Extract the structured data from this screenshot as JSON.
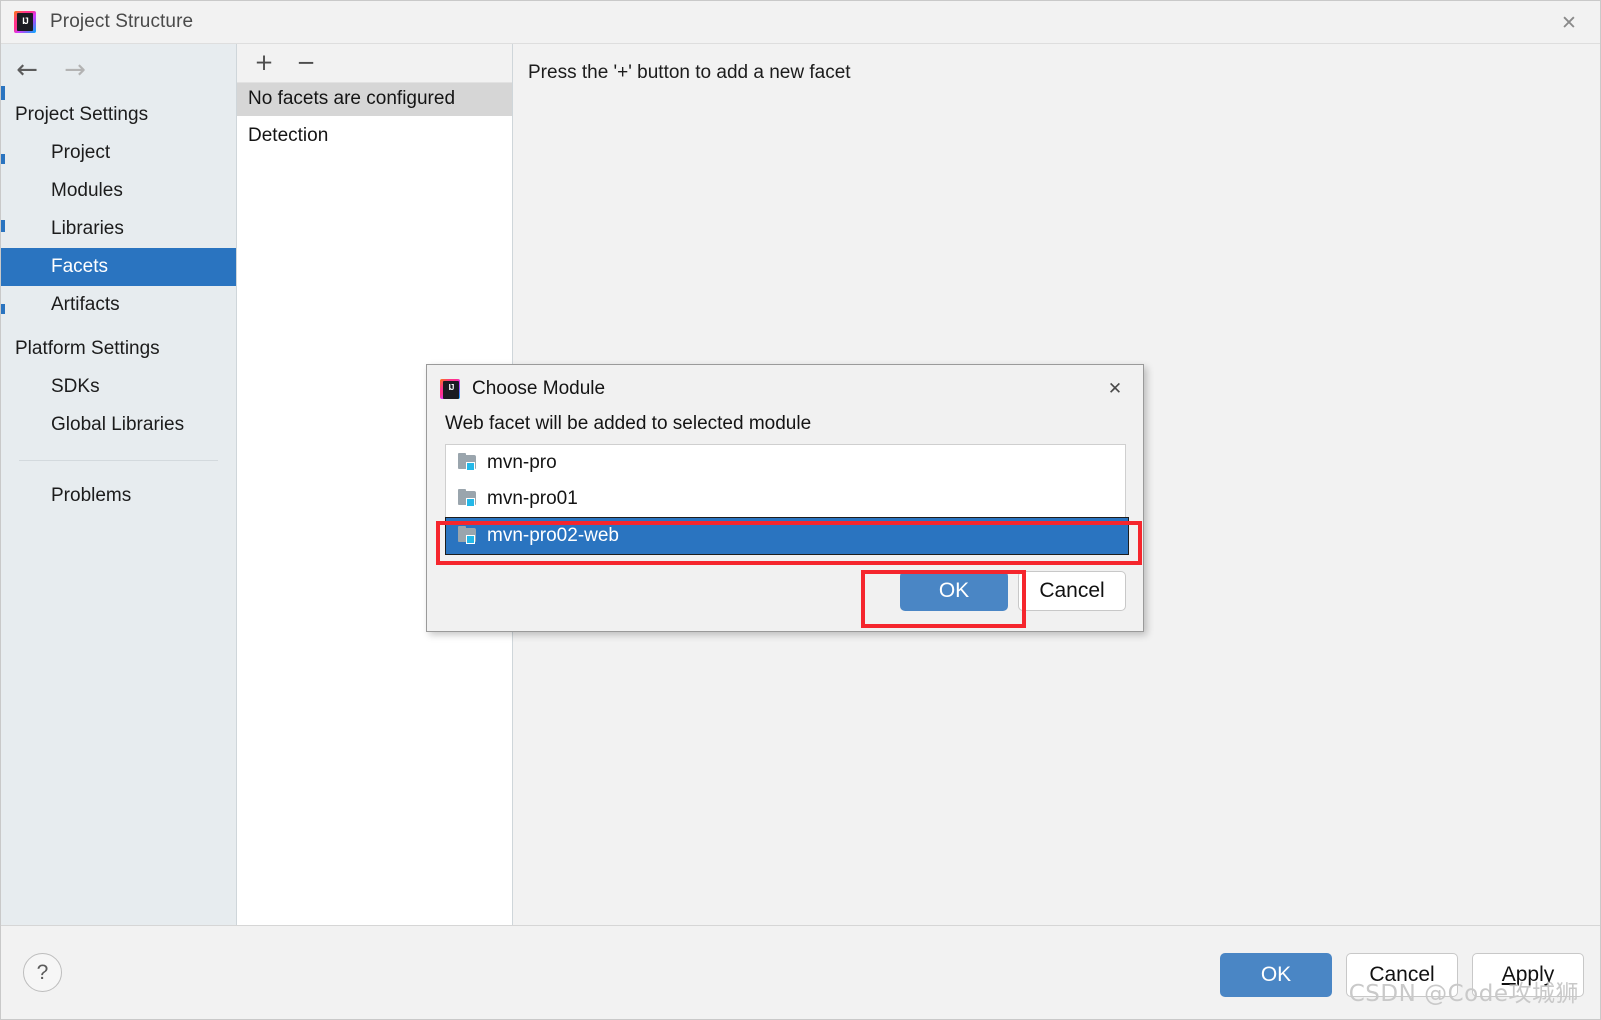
{
  "window": {
    "title": "Project Structure",
    "icon": "intellij-idea-icon",
    "close_label": "✕"
  },
  "nav": {
    "back_icon": "←",
    "forward_icon": "→"
  },
  "sidebar": {
    "groups": [
      {
        "label": "Project Settings",
        "items": [
          {
            "label": "Project",
            "selected": false
          },
          {
            "label": "Modules",
            "selected": false
          },
          {
            "label": "Libraries",
            "selected": false
          },
          {
            "label": "Facets",
            "selected": true
          },
          {
            "label": "Artifacts",
            "selected": false
          }
        ]
      },
      {
        "label": "Platform Settings",
        "items": [
          {
            "label": "SDKs",
            "selected": false
          },
          {
            "label": "Global Libraries",
            "selected": false
          }
        ]
      }
    ],
    "problems": {
      "label": "Problems"
    }
  },
  "facets": {
    "toolbar": {
      "add_label": "+",
      "remove_label": "−"
    },
    "header": "No facets are configured",
    "rows": [
      {
        "label": "Detection"
      }
    ]
  },
  "detail": {
    "hint": "Press the '+' button to add a new facet"
  },
  "bottom_bar": {
    "help_label": "?",
    "ok_label": "OK",
    "cancel_label": "Cancel",
    "apply_label": "Apply",
    "apply_mnemonic": "A",
    "apply_rest": "pply"
  },
  "dialog": {
    "title": "Choose Module",
    "icon": "intellij-idea-icon",
    "close_label": "✕",
    "prompt": "Web facet will be added to selected module",
    "modules": [
      {
        "label": "mvn-pro",
        "selected": false
      },
      {
        "label": "mvn-pro01",
        "selected": false
      },
      {
        "label": "mvn-pro02-web",
        "selected": true
      }
    ],
    "ok_label": "OK",
    "cancel_label": "Cancel"
  },
  "annotations": {
    "selected_row_highlight": "mvn-pro02-web",
    "ok_button_highlight": "OK",
    "color": "#f5262d"
  },
  "watermark": {
    "text": "CSDN @Code攻城狮"
  },
  "colors": {
    "accent_blue": "#2a74c0",
    "button_blue": "#4a86c5",
    "sidebar_bg": "#e7ecef",
    "window_bg": "#f2f2f2",
    "annotation_red": "#f5262d"
  }
}
